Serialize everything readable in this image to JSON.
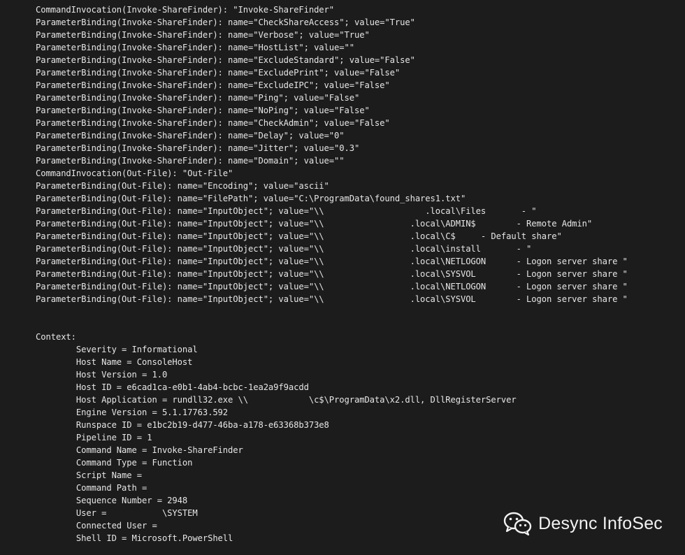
{
  "log_lines": [
    "CommandInvocation(Invoke-ShareFinder): \"Invoke-ShareFinder\"",
    "ParameterBinding(Invoke-ShareFinder): name=\"CheckShareAccess\"; value=\"True\"",
    "ParameterBinding(Invoke-ShareFinder): name=\"Verbose\"; value=\"True\"",
    "ParameterBinding(Invoke-ShareFinder): name=\"HostList\"; value=\"\"",
    "ParameterBinding(Invoke-ShareFinder): name=\"ExcludeStandard\"; value=\"False\"",
    "ParameterBinding(Invoke-ShareFinder): name=\"ExcludePrint\"; value=\"False\"",
    "ParameterBinding(Invoke-ShareFinder): name=\"ExcludeIPC\"; value=\"False\"",
    "ParameterBinding(Invoke-ShareFinder): name=\"Ping\"; value=\"False\"",
    "ParameterBinding(Invoke-ShareFinder): name=\"NoPing\"; value=\"False\"",
    "ParameterBinding(Invoke-ShareFinder): name=\"CheckAdmin\"; value=\"False\"",
    "ParameterBinding(Invoke-ShareFinder): name=\"Delay\"; value=\"0\"",
    "ParameterBinding(Invoke-ShareFinder): name=\"Jitter\"; value=\"0.3\"",
    "ParameterBinding(Invoke-ShareFinder): name=\"Domain\"; value=\"\"",
    "CommandInvocation(Out-File): \"Out-File\"",
    "ParameterBinding(Out-File): name=\"Encoding\"; value=\"ascii\"",
    "ParameterBinding(Out-File): name=\"FilePath\"; value=\"C:\\ProgramData\\found_shares1.txt\"",
    "ParameterBinding(Out-File): name=\"InputObject\"; value=\"\\\\                    .local\\Files       - \"",
    "ParameterBinding(Out-File): name=\"InputObject\"; value=\"\\\\                 .local\\ADMIN$        - Remote Admin\"",
    "ParameterBinding(Out-File): name=\"InputObject\"; value=\"\\\\                 .local\\C$     - Default share\"",
    "ParameterBinding(Out-File): name=\"InputObject\"; value=\"\\\\                 .local\\install       - \"",
    "ParameterBinding(Out-File): name=\"InputObject\"; value=\"\\\\                 .local\\NETLOGON      - Logon server share \"",
    "ParameterBinding(Out-File): name=\"InputObject\"; value=\"\\\\                 .local\\SYSVOL        - Logon server share \"",
    "ParameterBinding(Out-File): name=\"InputObject\"; value=\"\\\\                 .local\\NETLOGON      - Logon server share \"",
    "ParameterBinding(Out-File): name=\"InputObject\"; value=\"\\\\                 .local\\SYSVOL        - Logon server share \""
  ],
  "context": {
    "header": "Context:",
    "fields": [
      "Severity = Informational",
      "Host Name = ConsoleHost",
      "Host Version = 1.0",
      "Host ID = e6cad1ca-e0b1-4ab4-bcbc-1ea2a9f9acdd",
      "Host Application = rundll32.exe \\\\            \\c$\\ProgramData\\x2.dll, DllRegisterServer",
      "Engine Version = 5.1.17763.592",
      "Runspace ID = e1bc2b19-d477-46ba-a178-e63368b373e8",
      "Pipeline ID = 1",
      "Command Name = Invoke-ShareFinder",
      "Command Type = Function",
      "Script Name =",
      "Command Path =",
      "Sequence Number = 2948",
      "User =           \\SYSTEM",
      "Connected User =",
      "Shell ID = Microsoft.PowerShell"
    ]
  },
  "watermark": {
    "text": "Desync InfoSec",
    "icon": "wechat-icon"
  }
}
